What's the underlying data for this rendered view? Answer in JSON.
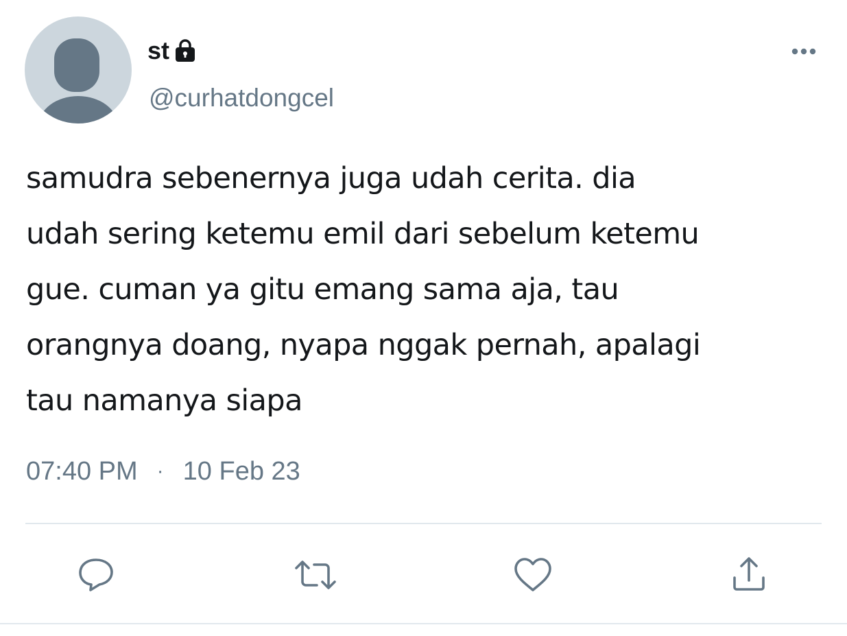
{
  "user": {
    "display_name": "st",
    "handle": "@curhatdongcel",
    "avatar_icon": "default-avatar-icon",
    "protected_icon": "lock-icon"
  },
  "tweet": {
    "text": "samudra sebenernya juga udah cerita. dia\nudah sering ketemu emil dari sebelum ketemu\ngue. cuman ya gitu emang sama aja, tau\norangnya doang, nyapa nggak pernah, apalagi\ntau namanya siapa",
    "time": "07:40 PM",
    "separator": "·",
    "date": "10 Feb 23"
  },
  "actions": [
    {
      "name": "reply",
      "icon": "reply-icon"
    },
    {
      "name": "retweet",
      "icon": "retweet-icon"
    },
    {
      "name": "like",
      "icon": "heart-icon"
    },
    {
      "name": "share",
      "icon": "share-icon"
    }
  ],
  "menu": {
    "icon": "more-options-icon"
  },
  "colors": {
    "text": "#14171a",
    "secondary": "#657786",
    "avatar_bg": "#ccd6dd",
    "avatar_figure": "#657786",
    "divider": "#e1e8ed"
  }
}
